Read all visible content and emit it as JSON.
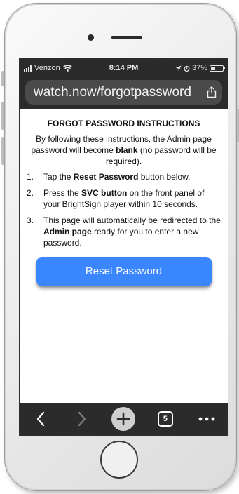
{
  "status": {
    "carrier": "Verizon",
    "time": "8:14 PM",
    "battery_percent": "37%",
    "battery_level": 0.37
  },
  "browser": {
    "url": "watch.now/forgotpassword",
    "tab_count": "5",
    "icons": {
      "signal": "signal-bars-icon",
      "wifi": "wifi-icon",
      "location": "location-arrow-icon",
      "alarm": "alarm-icon",
      "battery": "battery-icon",
      "share": "share-icon",
      "back": "back-arrow-icon",
      "forward": "forward-arrow-icon",
      "new_tab": "plus-icon",
      "tabs": "tabs-icon",
      "menu": "more-dots-icon"
    }
  },
  "page": {
    "title": "FORGOT PASSWORD INSTRUCTIONS",
    "intro_before": "By following these instructions, the Admin page password will become ",
    "intro_bold": "blank",
    "intro_after": " (no password will be required).",
    "steps": [
      {
        "num": "1.",
        "before": "Tap the ",
        "bold": "Reset Password",
        "after": " button below."
      },
      {
        "num": "2.",
        "before": "Press the ",
        "bold": "SVC button",
        "after": " on the front panel of your BrightSign player within 10 seconds."
      },
      {
        "num": "3.",
        "before": "This page will automatically be redirected to the ",
        "bold": "Admin page",
        "after": " ready for you to enter a new password."
      }
    ],
    "button_label": "Reset Password"
  },
  "colors": {
    "button": "#3a86ff",
    "chrome": "#2b2b2b",
    "url_pill": "#4a4a4a"
  }
}
